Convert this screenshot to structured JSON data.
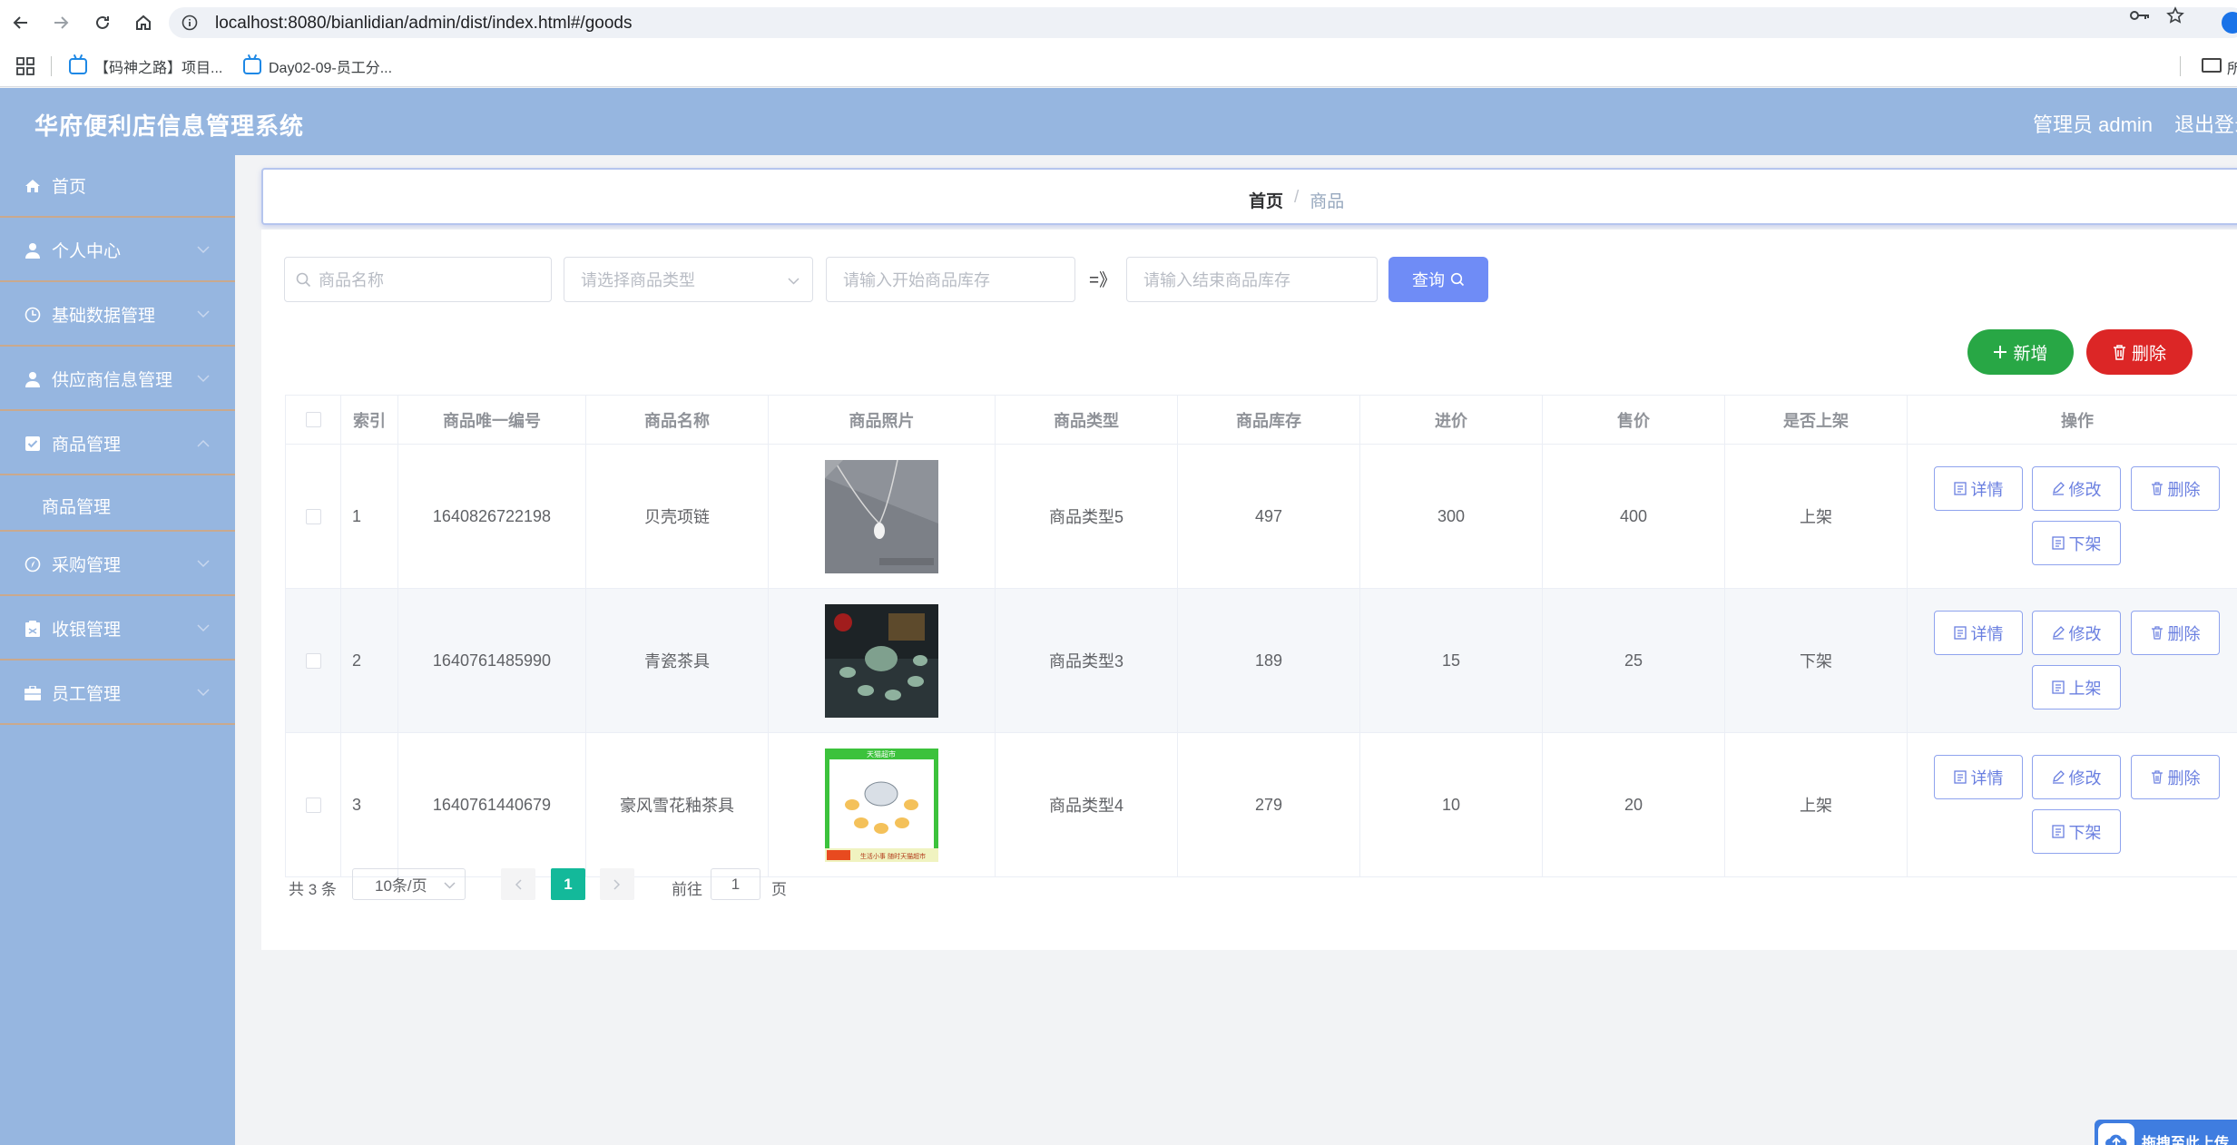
{
  "browser": {
    "url": "localhost:8080/bianlidian/admin/dist/index.html#/goods",
    "bookmarks": [
      {
        "label": "【码神之路】项目..."
      },
      {
        "label": "Day02-09-员工分..."
      }
    ],
    "folder_label": "所"
  },
  "header": {
    "title": "华府便利店信息管理系统",
    "admin": "管理员 admin",
    "logout": "退出登录"
  },
  "sidebar": {
    "items": [
      {
        "label": "首页",
        "icon": "home-icon"
      },
      {
        "label": "个人中心",
        "icon": "user-icon"
      },
      {
        "label": "基础数据管理",
        "icon": "clock-icon"
      },
      {
        "label": "供应商信息管理",
        "icon": "user-icon"
      },
      {
        "label": "商品管理",
        "icon": "checkbox-icon"
      },
      {
        "label": "商品管理",
        "icon": ""
      },
      {
        "label": "采购管理",
        "icon": "compass-icon"
      },
      {
        "label": "收银管理",
        "icon": "clipboard-icon"
      },
      {
        "label": "员工管理",
        "icon": "briefcase-icon"
      }
    ]
  },
  "breadcrumb": {
    "home": "首页",
    "separator": "/",
    "current": "商品"
  },
  "filters": {
    "name_placeholder": "商品名称",
    "type_placeholder": "请选择商品类型",
    "stock_start_placeholder": "请输入开始商品库存",
    "range_separator": "=》",
    "stock_end_placeholder": "请输入结束商品库存",
    "query_label": "查询"
  },
  "actions": {
    "add_label": "新增",
    "delete_label": "删除"
  },
  "table": {
    "columns": [
      "索引",
      "商品唯一编号",
      "商品名称",
      "商品照片",
      "商品类型",
      "商品库存",
      "进价",
      "售价",
      "是否上架",
      "操作"
    ],
    "rows": [
      {
        "index": "1",
        "code": "1640826722198",
        "name": "贝壳项链",
        "type": "商品类型5",
        "stock": "497",
        "cost": "300",
        "price": "400",
        "shelf": "上架",
        "toggle": "下架"
      },
      {
        "index": "2",
        "code": "1640761485990",
        "name": "青瓷茶具",
        "type": "商品类型3",
        "stock": "189",
        "cost": "15",
        "price": "25",
        "shelf": "下架",
        "toggle": "上架"
      },
      {
        "index": "3",
        "code": "1640761440679",
        "name": "豪风雪花釉茶具",
        "type": "商品类型4",
        "stock": "279",
        "cost": "10",
        "price": "20",
        "shelf": "上架",
        "toggle": "下架"
      }
    ],
    "op_detail": "详情",
    "op_edit": "修改",
    "op_delete": "删除"
  },
  "pagination": {
    "total": "共 3 条",
    "page_size": "10条/页",
    "current_page": "1",
    "goto_label": "前往",
    "goto_value": "1",
    "goto_unit": "页"
  },
  "photo_captions": {
    "tea_set_banner": "天猫超市",
    "tea_set_promo": "生活小事 随时天猫超市"
  },
  "upload": {
    "label": "拖拽至此上传"
  },
  "colors": {
    "sidebar_bg": "#96b6e0",
    "accent_blue": "#6f8cf6",
    "add_green": "#28a745",
    "delete_red": "#dc2626",
    "page_active": "#13b99a"
  }
}
